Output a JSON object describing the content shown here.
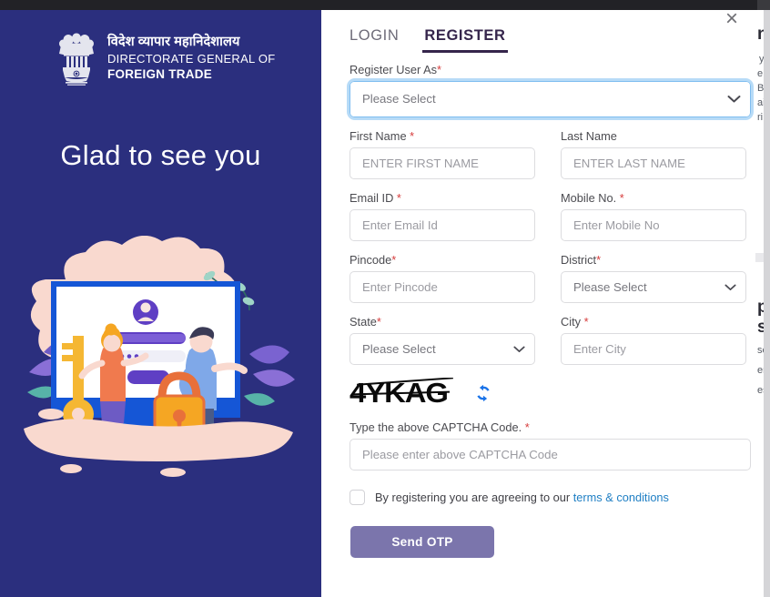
{
  "colors": {
    "hero_bg": "#2b2f7e",
    "tab_active": "#35254b",
    "button_primary": "#7b75ac",
    "link": "#1f7fc4",
    "required_star": "#d63b3b",
    "focus_ring": "#b7dbf7",
    "refresh_icon": "#1a73e8",
    "top_chrome": "#222226"
  },
  "hero": {
    "brand": {
      "hindi": "विदेश व्यापार महानिदेशालय",
      "line1": "DIRECTORATE GENERAL OF",
      "line2": "FOREIGN TRADE",
      "emblem_name": "india-national-emblem"
    },
    "title": "Glad to see you",
    "illustration_name": "login-security-illustration"
  },
  "modal": {
    "close_label": "×",
    "tabs": [
      {
        "label": "LOGIN",
        "active": false
      },
      {
        "label": "REGISTER",
        "active": true
      }
    ]
  },
  "form": {
    "register_user_as": {
      "label": "Register User As",
      "required": true,
      "value": "Please Select"
    },
    "first_name": {
      "label": "First Name ",
      "required": true,
      "placeholder": "ENTER FIRST NAME",
      "value": ""
    },
    "last_name": {
      "label": "Last Name",
      "required": false,
      "placeholder": "ENTER LAST NAME",
      "value": ""
    },
    "email_id": {
      "label": "Email ID ",
      "required": true,
      "placeholder": "Enter Email Id",
      "value": ""
    },
    "mobile_no": {
      "label": "Mobile No. ",
      "required": true,
      "placeholder": "Enter Mobile No",
      "value": ""
    },
    "pincode": {
      "label": "Pincode",
      "required": true,
      "placeholder": "Enter Pincode",
      "value": ""
    },
    "district": {
      "label": "District",
      "required": true,
      "value": "Please Select"
    },
    "state": {
      "label": "State",
      "required": true,
      "value": "Please Select"
    },
    "city": {
      "label": "City ",
      "required": true,
      "placeholder": "Enter City",
      "value": ""
    },
    "captcha": {
      "code": "4YKAG",
      "refresh_icon_name": "refresh-icon",
      "input_label": "Type the above CAPTCHA Code. ",
      "input_required": true,
      "input_placeholder": "Please enter above CAPTCHA Code",
      "input_value": ""
    },
    "terms": {
      "checked": false,
      "text": "By registering you are agreeing to our",
      "link_text": "terms & conditions"
    },
    "submit_label": "Send OTP",
    "required_marker": "*"
  },
  "background_page": {
    "fragments": [
      "n",
      "y",
      "e,",
      "Br",
      "ai",
      "ri",
      "p",
      "sp",
      "se",
      "en",
      "es"
    ]
  }
}
